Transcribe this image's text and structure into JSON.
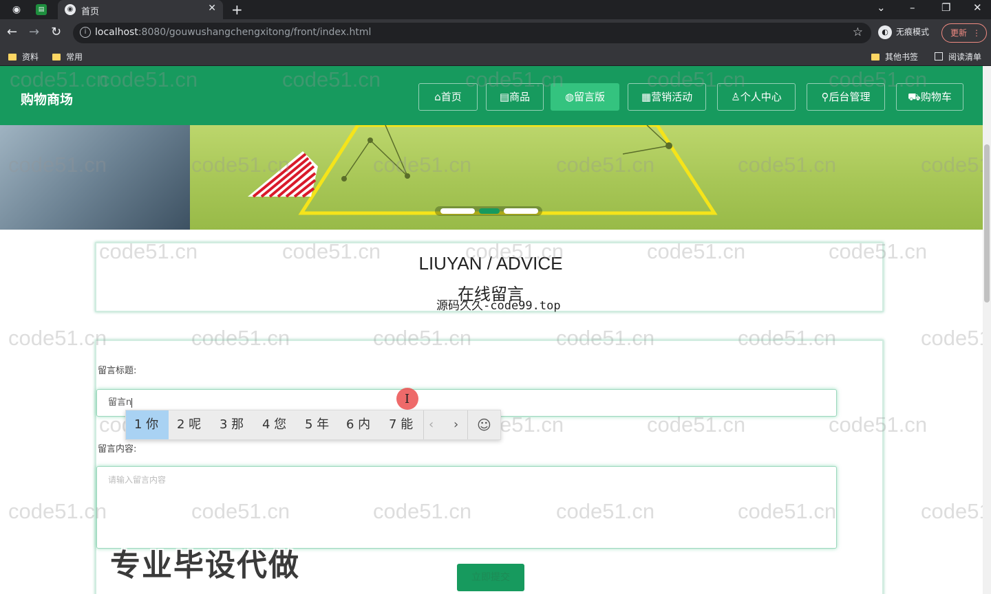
{
  "browser": {
    "tab_title": "首页",
    "url_host": "localhost",
    "url_rest": ":8080/gouwushangchengxitong/front/index.html",
    "incognito_label": "无痕模式",
    "update_label": "更新",
    "bookmarks": [
      "资料",
      "常用"
    ],
    "bookmarks_right": [
      "其他书签",
      "阅读清单"
    ]
  },
  "site": {
    "title": "购物商场",
    "nav": [
      {
        "icon": "⌂",
        "label": "首页"
      },
      {
        "icon": "▤",
        "label": "商品"
      },
      {
        "icon": "◍",
        "label": "留言版"
      },
      {
        "icon": "▦",
        "label": "营销活动"
      },
      {
        "icon": "♙",
        "label": "个人中心"
      },
      {
        "icon": "⚲",
        "label": "后台管理"
      },
      {
        "icon": "⛟",
        "label": "购物车"
      }
    ],
    "active_nav": "留言版"
  },
  "advice": {
    "title": "LIUYAN / ADVICE",
    "subtitle": "在线留言",
    "overlay_watermark": "源码久久-code99.top"
  },
  "form": {
    "title_label": "留言标题:",
    "title_value": "留言n",
    "content_label": "留言内容:",
    "content_placeholder": "请输入留言内容",
    "submit_label": "立即提交"
  },
  "ime": {
    "candidates": [
      "1 你",
      "2 呢",
      "3 那",
      "4 您",
      "5 年",
      "6 内",
      "7 能"
    ],
    "prev": "‹",
    "next": "›",
    "emoji": "☺"
  },
  "watermark": "code51.cn",
  "promo_overlay": "专业毕设代做",
  "colors": {
    "brand_green": "#179a5e",
    "active_nav": "#34c37f"
  }
}
